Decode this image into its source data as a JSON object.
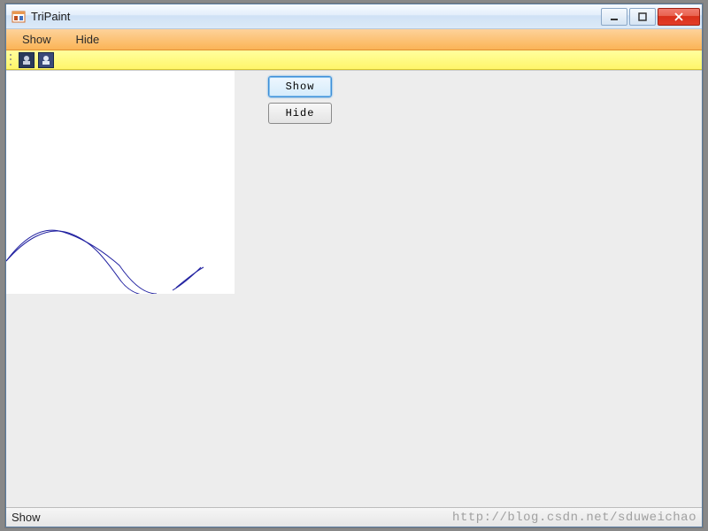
{
  "window": {
    "title": "TriPaint"
  },
  "menu": {
    "items": [
      {
        "label": "Show"
      },
      {
        "label": "Hide"
      }
    ]
  },
  "toolbar": {
    "icons": [
      {
        "name": "tool-icon-1"
      },
      {
        "name": "tool-icon-2"
      }
    ]
  },
  "buttons": {
    "show": "Show",
    "hide": "Hide"
  },
  "statusbar": {
    "text": "Show"
  },
  "watermark": "http://blog.csdn.net/sduweichao",
  "chart_data": {
    "type": "line",
    "title": "",
    "xlabel": "",
    "ylabel": "",
    "x": [
      0,
      32,
      64,
      96,
      128,
      160,
      192,
      224,
      256
    ],
    "values": [
      215,
      192,
      182,
      193,
      220,
      250,
      255,
      245,
      222
    ],
    "xlim": [
      0,
      258
    ],
    "ylim": [
      0,
      252
    ],
    "note": "sine-like curve drawn on white canvas; y is pixel position from top"
  }
}
